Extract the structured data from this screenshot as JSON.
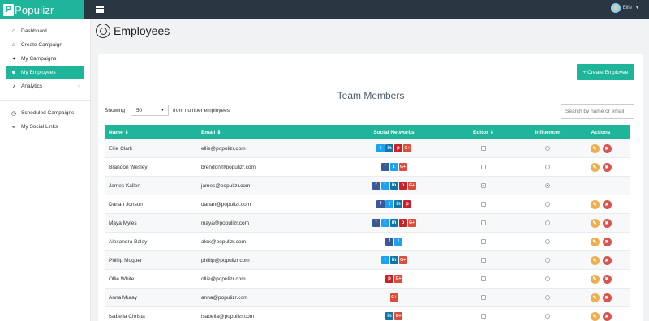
{
  "brand": {
    "name": "Populizr",
    "logo": "P"
  },
  "topbar": {
    "user_name": "Ellie",
    "menu_icon": "hamburger-icon"
  },
  "sidebar": {
    "items": [
      {
        "label": "Dashboard",
        "icon": "home-icon",
        "glyph": "⌂",
        "active": false
      },
      {
        "label": "Create Campaign",
        "icon": "home-icon",
        "glyph": "⌂",
        "active": false
      },
      {
        "label": "My Campaigns",
        "icon": "megaphone-icon",
        "glyph": "◄",
        "active": false
      },
      {
        "label": "My Employees",
        "icon": "users-icon",
        "glyph": "☻",
        "active": true
      },
      {
        "label": "Analytics",
        "icon": "chart-icon",
        "glyph": "↗",
        "active": false,
        "has_arrow": true
      }
    ],
    "items2": [
      {
        "label": "Scheduled Campaigns",
        "icon": "clock-icon",
        "glyph": "◷"
      },
      {
        "label": "My Social Links",
        "icon": "link-icon",
        "glyph": "⚭"
      }
    ]
  },
  "page": {
    "title": "Employees"
  },
  "panel": {
    "create_button": "+ Create Employee",
    "team_title": "Team Members",
    "showing_label": "Showing",
    "showing_value": "50",
    "showing_suffix": "from number employees",
    "search_placeholder": "Search by name or email"
  },
  "table": {
    "headers": {
      "name": "Name ⇕",
      "email": "Email ⇕",
      "social": "Social Networks",
      "editor": "Editor ⇕",
      "influencer": "Influencer",
      "actions": "Actions"
    },
    "rows": [
      {
        "name": "Ellie Clark",
        "email": "ellie@populizr.com",
        "social": [
          "twitter",
          "linkedin",
          "pinterest",
          "google"
        ],
        "editor": false,
        "influencer": false,
        "actions": true
      },
      {
        "name": "Brandon Wesley",
        "email": "brendon@populizr.com",
        "social": [
          "facebook",
          "twitter",
          "google"
        ],
        "editor": false,
        "influencer": false,
        "actions": true
      },
      {
        "name": "James Kallen",
        "email": "james@populizr.com",
        "social": [
          "facebook",
          "twitter",
          "linkedin",
          "pinterest",
          "google"
        ],
        "editor": true,
        "influencer": true,
        "actions": false
      },
      {
        "name": "Danan Jonson",
        "email": "danan@populizr.com",
        "social": [
          "facebook",
          "twitter",
          "linkedin",
          "pinterest"
        ],
        "editor": false,
        "influencer": false,
        "actions": true
      },
      {
        "name": "Maya Myles",
        "email": "maya@populizr.com",
        "social": [
          "facebook",
          "twitter",
          "linkedin",
          "pinterest",
          "google"
        ],
        "editor": false,
        "influencer": false,
        "actions": true
      },
      {
        "name": "Alexandra Baley",
        "email": "alex@populizr.com",
        "social": [
          "facebook",
          "twitter"
        ],
        "editor": false,
        "influencer": false,
        "actions": true
      },
      {
        "name": "Phillip Moguer",
        "email": "phillip@populizr.com",
        "social": [
          "twitter",
          "linkedin",
          "google"
        ],
        "editor": false,
        "influencer": false,
        "actions": true
      },
      {
        "name": "Ollie White",
        "email": "ollie@populizr.com",
        "social": [
          "pinterest",
          "google"
        ],
        "editor": false,
        "influencer": false,
        "actions": true
      },
      {
        "name": "Anna Muray",
        "email": "anna@populizr.com",
        "social": [
          "google"
        ],
        "editor": false,
        "influencer": false,
        "actions": true
      },
      {
        "name": "Isabella Christa",
        "email": "isabella@populizr.com",
        "social": [
          "linkedin",
          "google"
        ],
        "editor": false,
        "influencer": false,
        "actions": true
      }
    ]
  },
  "social_glyphs": {
    "facebook": "f",
    "twitter": "t",
    "linkedin": "in",
    "pinterest": "p",
    "google": "G+"
  },
  "colors": {
    "accent": "#1fb59a",
    "topbar": "#2b3643",
    "edit": "#f0ad4e",
    "delete": "#d9534f"
  }
}
